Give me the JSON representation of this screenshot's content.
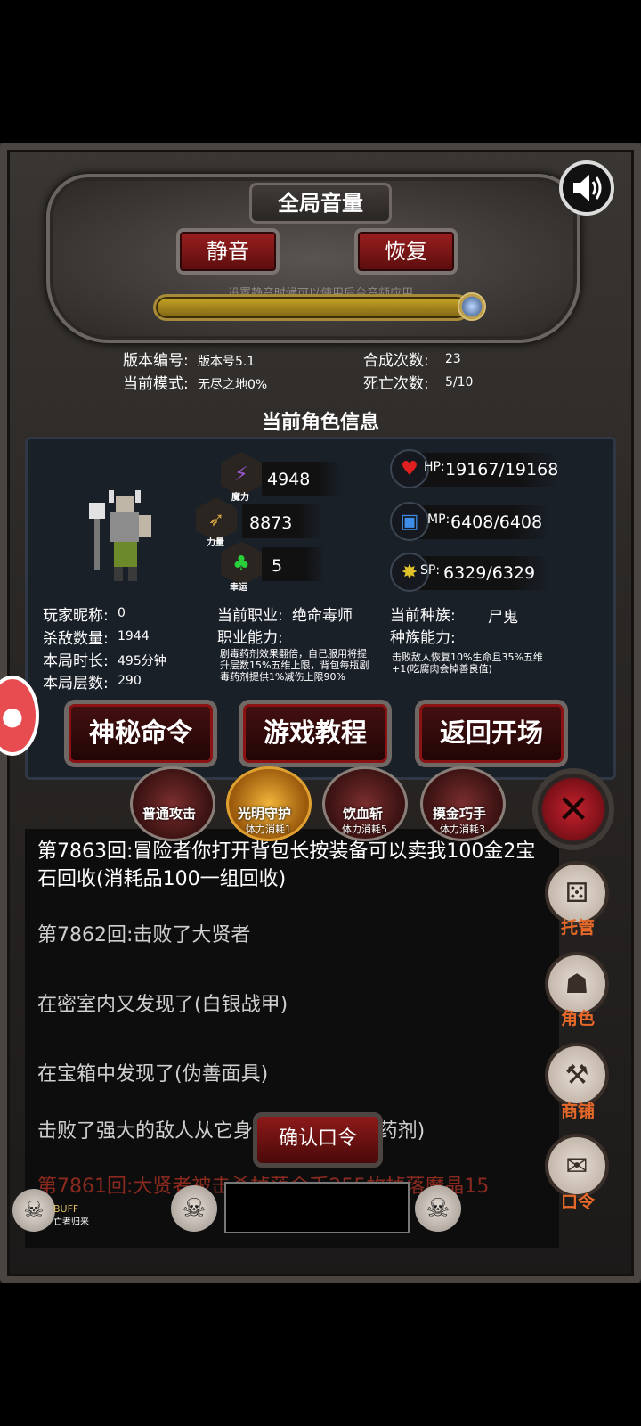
{
  "volume": {
    "title": "全局音量",
    "mute_label": "静音",
    "restore_label": "恢复",
    "hint": "设置静音时候可以使用后台音频应用"
  },
  "game_info": {
    "version_label": "版本编号:",
    "version_value": "版本号5.1",
    "mode_label": "当前模式:",
    "mode_value": "无尽之地0%",
    "craft_label": "合成次数:",
    "craft_value": "23",
    "death_label": "死亡次数:",
    "death_value": "5/10"
  },
  "character": {
    "section_title": "当前角色信息",
    "magic_value": "4948",
    "magic_label": "魔力",
    "strength_value": "8873",
    "strength_label": "力量",
    "luck_value": "5",
    "luck_label": "幸运",
    "hp_label": "HP:",
    "hp_value": "19167/19168",
    "mp_label": "MP:",
    "mp_value": "6408/6408",
    "sp_label": "SP:",
    "sp_value": "6329/6329",
    "nickname_label": "玩家昵称:",
    "nickname_value": "0",
    "kills_label": "杀敌数量:",
    "kills_value": "1944",
    "duration_label": "本局时长:",
    "duration_value": "495分钟",
    "floor_label": "本局层数:",
    "floor_value": "290",
    "job_label": "当前职业:",
    "job_value": "绝命毒师",
    "job_ability_label": "职业能力:",
    "job_ability_text": "剧毒药剂效果翻倍，自己服用将提升层数15%五维上限，背包每瓶剧毒药剂提供1%减伤上限90%",
    "race_label": "当前种族:",
    "race_value": "尸鬼",
    "race_ability_label": "种族能力:",
    "race_ability_text": "击败敌人恢复10%生命且35%五维+1(吃腐肉会掉善良值)"
  },
  "actions": {
    "mystery": "神秘命令",
    "tutorial": "游戏教程",
    "back": "返回开场"
  },
  "skills": [
    {
      "name": "普通攻击",
      "cost": ""
    },
    {
      "name": "光明守护",
      "cost": "体力消耗1"
    },
    {
      "name": "饮血斩",
      "cost": "体力消耗5"
    },
    {
      "name": "摸金巧手",
      "cost": "体力消耗3"
    }
  ],
  "log": [
    "第7863回:冒险者你打开背包长按装备可以卖我100金2宝石回收(消耗品100一组回收)",
    "第7862回:击败了大贤者",
    "在密室内又发现了(白银战甲)",
    "在宝箱中发现了(伪善面具)",
    "击败了强大的敌人从它身上取出了(体力药剂)",
    "第7861回:大贤者被击杀掉落金币255枚掉落魔晶15"
  ],
  "side_menu": {
    "auto": "托管",
    "role": "角色",
    "shop": "商铺",
    "command": "口令"
  },
  "confirm_label": "确认口令",
  "buff": {
    "title": "BUFF",
    "sub": "亡者归来"
  },
  "colors": {
    "accent_red": "#9b1f1f",
    "side_label": "#e7692a",
    "slider_gold": "#c9a826"
  }
}
